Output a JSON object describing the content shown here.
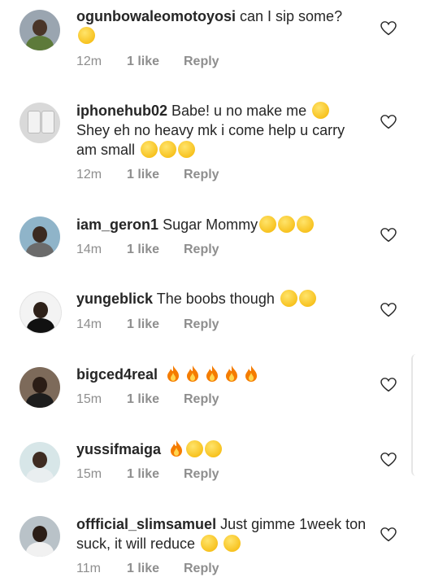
{
  "comments": [
    {
      "username": "ogunbowaleomotoyosi",
      "text": "can I sip some?",
      "emojis": [
        "yum-face"
      ],
      "time": "12m",
      "likes": "1 like",
      "reply": "Reply"
    },
    {
      "username": "iphonehub02",
      "text": "Babe! u no make me",
      "emojis_inline": [
        "weary-face"
      ],
      "text2": "Shey eh no heavy mk i come help u carry am small",
      "emojis": [
        "heart-eyes",
        "heart-eyes",
        "yum-face"
      ],
      "time": "12m",
      "likes": "1 like",
      "reply": "Reply"
    },
    {
      "username": "iam_geron1",
      "text": "Sugar Mommy",
      "emojis": [
        "heart-eyes",
        "heart-eyes",
        "heart-eyes"
      ],
      "time": "14m",
      "likes": "1 like",
      "reply": "Reply"
    },
    {
      "username": "yungeblick",
      "text": "The boobs though",
      "emojis": [
        "heart-eyes",
        "yum-face"
      ],
      "time": "14m",
      "likes": "1 like",
      "reply": "Reply"
    },
    {
      "username": "bigced4real",
      "text": "",
      "emojis": [
        "fire",
        "fire",
        "fire",
        "fire",
        "fire"
      ],
      "time": "15m",
      "likes": "1 like",
      "reply": "Reply"
    },
    {
      "username": "yussifmaiga",
      "text": "",
      "emojis": [
        "fire",
        "heart-eyes",
        "yum-face"
      ],
      "time": "15m",
      "likes": "1 like",
      "reply": "Reply"
    },
    {
      "username": "offficial_slimsamuel",
      "text": "Just gimme 1week ton suck, it will reduce",
      "emojis": [
        "heart-eyes",
        "kissing-heart"
      ],
      "time": "11m",
      "likes": "1 like",
      "reply": "Reply"
    }
  ],
  "colors": {
    "text": "#262626",
    "meta": "#8e8e8e",
    "heart_outline": "#262626"
  }
}
